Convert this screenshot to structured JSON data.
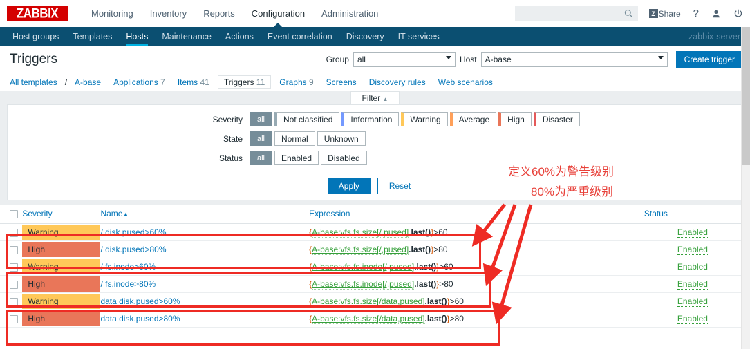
{
  "header": {
    "logo_text": "ZABBIX",
    "menu": [
      {
        "label": "Monitoring",
        "selected": false
      },
      {
        "label": "Inventory",
        "selected": false
      },
      {
        "label": "Reports",
        "selected": false
      },
      {
        "label": "Configuration",
        "selected": true
      },
      {
        "label": "Administration",
        "selected": false
      }
    ],
    "search_placeholder": "",
    "search_value": "",
    "share_label": "Share",
    "share_badge": "Z",
    "help_icon": "?",
    "user_icon": "user-icon",
    "power_icon": "power-icon",
    "search_icon": "search-icon"
  },
  "subnav": {
    "items": [
      {
        "label": "Host groups",
        "selected": false
      },
      {
        "label": "Templates",
        "selected": false
      },
      {
        "label": "Hosts",
        "selected": true
      },
      {
        "label": "Maintenance",
        "selected": false
      },
      {
        "label": "Actions",
        "selected": false
      },
      {
        "label": "Event correlation",
        "selected": false
      },
      {
        "label": "Discovery",
        "selected": false
      },
      {
        "label": "IT services",
        "selected": false
      }
    ],
    "server": "zabbix-server"
  },
  "page": {
    "title": "Triggers",
    "group_label": "Group",
    "group_value": "all",
    "host_label": "Host",
    "host_value": "A-base",
    "create_button": "Create trigger"
  },
  "breadcrumb": {
    "all_templates": "All templates",
    "separator": "/",
    "template": "A-base",
    "items": [
      {
        "label": "Applications",
        "count": "7",
        "current": false
      },
      {
        "label": "Items",
        "count": "41",
        "current": false
      },
      {
        "label": "Triggers",
        "count": "11",
        "current": true
      },
      {
        "label": "Graphs",
        "count": "9",
        "current": false
      },
      {
        "label": "Screens",
        "count": "",
        "current": false
      },
      {
        "label": "Discovery rules",
        "count": "",
        "current": false
      },
      {
        "label": "Web scenarios",
        "count": "",
        "current": false
      }
    ]
  },
  "filter": {
    "tab_label": "Filter",
    "tab_caret": "▲",
    "rows": [
      {
        "label": "Severity",
        "options": [
          {
            "label": "all",
            "active": true,
            "accent": ""
          },
          {
            "label": "Not classified",
            "active": false,
            "accent": "#97aab3"
          },
          {
            "label": "Information",
            "active": false,
            "accent": "#7499ff"
          },
          {
            "label": "Warning",
            "active": false,
            "accent": "#ffc859"
          },
          {
            "label": "Average",
            "active": false,
            "accent": "#ffa059"
          },
          {
            "label": "High",
            "active": false,
            "accent": "#e97659"
          },
          {
            "label": "Disaster",
            "active": false,
            "accent": "#e45959"
          }
        ]
      },
      {
        "label": "State",
        "options": [
          {
            "label": "all",
            "active": true,
            "accent": ""
          },
          {
            "label": "Normal",
            "active": false,
            "accent": ""
          },
          {
            "label": "Unknown",
            "active": false,
            "accent": ""
          }
        ]
      },
      {
        "label": "Status",
        "options": [
          {
            "label": "all",
            "active": true,
            "accent": ""
          },
          {
            "label": "Enabled",
            "active": false,
            "accent": ""
          },
          {
            "label": "Disabled",
            "active": false,
            "accent": ""
          }
        ]
      }
    ],
    "apply_label": "Apply",
    "reset_label": "Reset"
  },
  "table": {
    "columns": {
      "severity": "Severity",
      "name": "Name",
      "name_sort": "▲",
      "expression": "Expression",
      "status": "Status"
    },
    "rows": [
      {
        "severity": "Warning",
        "severity_class": "sev-warning",
        "name": "/ disk.pused>60%",
        "expr_open": "{",
        "expr_key": "A-base:vfs.fs.size[/,pused]",
        "expr_fn": ".last()",
        "expr_close": "}",
        "expr_tail": ">60",
        "status": "Enabled"
      },
      {
        "severity": "High",
        "severity_class": "sev-high",
        "name": "/ disk.pused>80%",
        "expr_open": "{",
        "expr_key": "A-base:vfs.fs.size[/,pused]",
        "expr_fn": ".last()",
        "expr_close": "}",
        "expr_tail": ">80",
        "status": "Enabled"
      },
      {
        "severity": "Warning",
        "severity_class": "sev-warning",
        "name": "/ fs.inode>60%",
        "expr_open": "{",
        "expr_key": "A-base:vfs.fs.inode[/,pused]",
        "expr_fn": ".last()",
        "expr_close": "}",
        "expr_tail": ">60",
        "status": "Enabled"
      },
      {
        "severity": "High",
        "severity_class": "sev-high",
        "name": "/ fs.inode>80%",
        "expr_open": "{",
        "expr_key": "A-base:vfs.fs.inode[/,pused]",
        "expr_fn": ".last()",
        "expr_close": "}",
        "expr_tail": ">80",
        "status": "Enabled"
      },
      {
        "severity": "Warning",
        "severity_class": "sev-warning",
        "name": "data disk.pused>60%",
        "expr_open": "{",
        "expr_key": "A-base:vfs.fs.size[/data,pused]",
        "expr_fn": ".last()",
        "expr_close": "}",
        "expr_tail": ">60",
        "status": "Enabled"
      },
      {
        "severity": "High",
        "severity_class": "sev-high",
        "name": "data disk.pused>80%",
        "expr_open": "{",
        "expr_key": "A-base:vfs.fs.size[/data,pused]",
        "expr_fn": ".last()",
        "expr_close": "}",
        "expr_tail": ">80",
        "status": "Enabled"
      }
    ]
  },
  "annotations": {
    "line1": "定义60%为警告级别",
    "line2": "80%为严重级别",
    "color": "#e8413a"
  }
}
